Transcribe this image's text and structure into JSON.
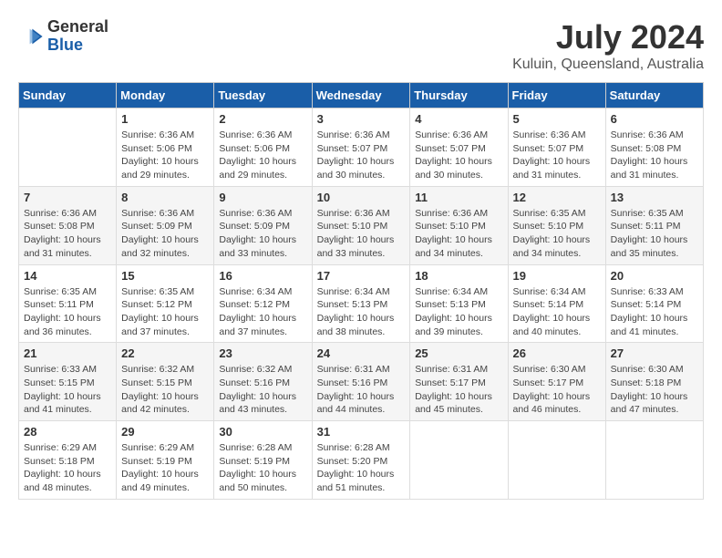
{
  "header": {
    "logo_general": "General",
    "logo_blue": "Blue",
    "month_year": "July 2024",
    "location": "Kuluin, Queensland, Australia"
  },
  "days_of_week": [
    "Sunday",
    "Monday",
    "Tuesday",
    "Wednesday",
    "Thursday",
    "Friday",
    "Saturday"
  ],
  "weeks": [
    [
      {
        "day": "",
        "sunrise": "",
        "sunset": "",
        "daylight": ""
      },
      {
        "day": "1",
        "sunrise": "6:36 AM",
        "sunset": "5:06 PM",
        "daylight": "10 hours and 29 minutes."
      },
      {
        "day": "2",
        "sunrise": "6:36 AM",
        "sunset": "5:06 PM",
        "daylight": "10 hours and 29 minutes."
      },
      {
        "day": "3",
        "sunrise": "6:36 AM",
        "sunset": "5:07 PM",
        "daylight": "10 hours and 30 minutes."
      },
      {
        "day": "4",
        "sunrise": "6:36 AM",
        "sunset": "5:07 PM",
        "daylight": "10 hours and 30 minutes."
      },
      {
        "day": "5",
        "sunrise": "6:36 AM",
        "sunset": "5:07 PM",
        "daylight": "10 hours and 31 minutes."
      },
      {
        "day": "6",
        "sunrise": "6:36 AM",
        "sunset": "5:08 PM",
        "daylight": "10 hours and 31 minutes."
      }
    ],
    [
      {
        "day": "7",
        "sunrise": "6:36 AM",
        "sunset": "5:08 PM",
        "daylight": "10 hours and 31 minutes."
      },
      {
        "day": "8",
        "sunrise": "6:36 AM",
        "sunset": "5:09 PM",
        "daylight": "10 hours and 32 minutes."
      },
      {
        "day": "9",
        "sunrise": "6:36 AM",
        "sunset": "5:09 PM",
        "daylight": "10 hours and 33 minutes."
      },
      {
        "day": "10",
        "sunrise": "6:36 AM",
        "sunset": "5:10 PM",
        "daylight": "10 hours and 33 minutes."
      },
      {
        "day": "11",
        "sunrise": "6:36 AM",
        "sunset": "5:10 PM",
        "daylight": "10 hours and 34 minutes."
      },
      {
        "day": "12",
        "sunrise": "6:35 AM",
        "sunset": "5:10 PM",
        "daylight": "10 hours and 34 minutes."
      },
      {
        "day": "13",
        "sunrise": "6:35 AM",
        "sunset": "5:11 PM",
        "daylight": "10 hours and 35 minutes."
      }
    ],
    [
      {
        "day": "14",
        "sunrise": "6:35 AM",
        "sunset": "5:11 PM",
        "daylight": "10 hours and 36 minutes."
      },
      {
        "day": "15",
        "sunrise": "6:35 AM",
        "sunset": "5:12 PM",
        "daylight": "10 hours and 37 minutes."
      },
      {
        "day": "16",
        "sunrise": "6:34 AM",
        "sunset": "5:12 PM",
        "daylight": "10 hours and 37 minutes."
      },
      {
        "day": "17",
        "sunrise": "6:34 AM",
        "sunset": "5:13 PM",
        "daylight": "10 hours and 38 minutes."
      },
      {
        "day": "18",
        "sunrise": "6:34 AM",
        "sunset": "5:13 PM",
        "daylight": "10 hours and 39 minutes."
      },
      {
        "day": "19",
        "sunrise": "6:34 AM",
        "sunset": "5:14 PM",
        "daylight": "10 hours and 40 minutes."
      },
      {
        "day": "20",
        "sunrise": "6:33 AM",
        "sunset": "5:14 PM",
        "daylight": "10 hours and 41 minutes."
      }
    ],
    [
      {
        "day": "21",
        "sunrise": "6:33 AM",
        "sunset": "5:15 PM",
        "daylight": "10 hours and 41 minutes."
      },
      {
        "day": "22",
        "sunrise": "6:32 AM",
        "sunset": "5:15 PM",
        "daylight": "10 hours and 42 minutes."
      },
      {
        "day": "23",
        "sunrise": "6:32 AM",
        "sunset": "5:16 PM",
        "daylight": "10 hours and 43 minutes."
      },
      {
        "day": "24",
        "sunrise": "6:31 AM",
        "sunset": "5:16 PM",
        "daylight": "10 hours and 44 minutes."
      },
      {
        "day": "25",
        "sunrise": "6:31 AM",
        "sunset": "5:17 PM",
        "daylight": "10 hours and 45 minutes."
      },
      {
        "day": "26",
        "sunrise": "6:30 AM",
        "sunset": "5:17 PM",
        "daylight": "10 hours and 46 minutes."
      },
      {
        "day": "27",
        "sunrise": "6:30 AM",
        "sunset": "5:18 PM",
        "daylight": "10 hours and 47 minutes."
      }
    ],
    [
      {
        "day": "28",
        "sunrise": "6:29 AM",
        "sunset": "5:18 PM",
        "daylight": "10 hours and 48 minutes."
      },
      {
        "day": "29",
        "sunrise": "6:29 AM",
        "sunset": "5:19 PM",
        "daylight": "10 hours and 49 minutes."
      },
      {
        "day": "30",
        "sunrise": "6:28 AM",
        "sunset": "5:19 PM",
        "daylight": "10 hours and 50 minutes."
      },
      {
        "day": "31",
        "sunrise": "6:28 AM",
        "sunset": "5:20 PM",
        "daylight": "10 hours and 51 minutes."
      },
      {
        "day": "",
        "sunrise": "",
        "sunset": "",
        "daylight": ""
      },
      {
        "day": "",
        "sunrise": "",
        "sunset": "",
        "daylight": ""
      },
      {
        "day": "",
        "sunrise": "",
        "sunset": "",
        "daylight": ""
      }
    ]
  ]
}
